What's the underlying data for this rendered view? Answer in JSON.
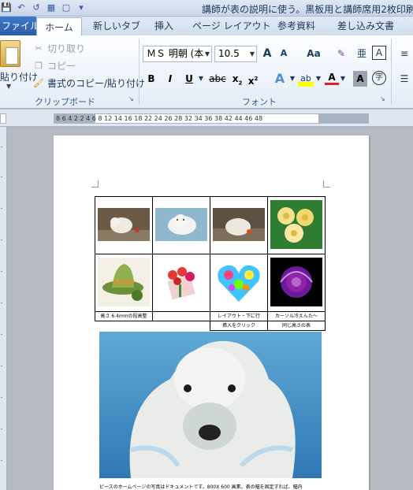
{
  "window": {
    "title": "講師が表の説明に使う。黒板用と講師席用2枚印刷.dc"
  },
  "tabs": {
    "file": "ファイル",
    "home": "ホーム",
    "insert_new": "新しいタブ",
    "insert": "挿入",
    "layout": "ページ レイアウト",
    "references": "参考資料",
    "mailings": "差し込み文書"
  },
  "clipboard": {
    "paste": "貼り付け",
    "cut": "切り取り",
    "copy": "コピー",
    "format_painter": "書式のコピー/貼り付け",
    "group_label": "クリップボード"
  },
  "font": {
    "name": "ＭＳ 明朝 (本",
    "size": "10.5",
    "group_label": "フォント",
    "grow": "A",
    "shrink": "A",
    "case": "Aa",
    "ruby": "亜",
    "border_char": "A",
    "bold": "B",
    "italic": "I",
    "underline": "U",
    "strike": "abc",
    "subscript": "x",
    "superscript": "x",
    "effects": "A",
    "highlight": "ab",
    "font_color": "A",
    "shading": "A",
    "enclose": "字"
  },
  "ruler": {
    "text": "8  6  4  2       2  4  6  8      12  14  16  18      22  24  26  28       32  34  36  38      42  44  46  48"
  },
  "table": {
    "captions_row1": [
      "高さ 6.4mmの段高整",
      "",
      "レイアウト・下に行",
      "カーソル冷えんた～"
    ],
    "captions_row2": [
      "",
      "",
      "挿入をクリック",
      "同じ高さの表"
    ]
  },
  "document": {
    "footer_text": "ピースのホームページの写真はドキュメントです。800X 600 画素。表の幅を固定すれば、幅内"
  },
  "colors": {
    "accent": "#2b579a",
    "file_tab": "#2a5ca8",
    "ribbon_bg": "#eef3fa"
  }
}
